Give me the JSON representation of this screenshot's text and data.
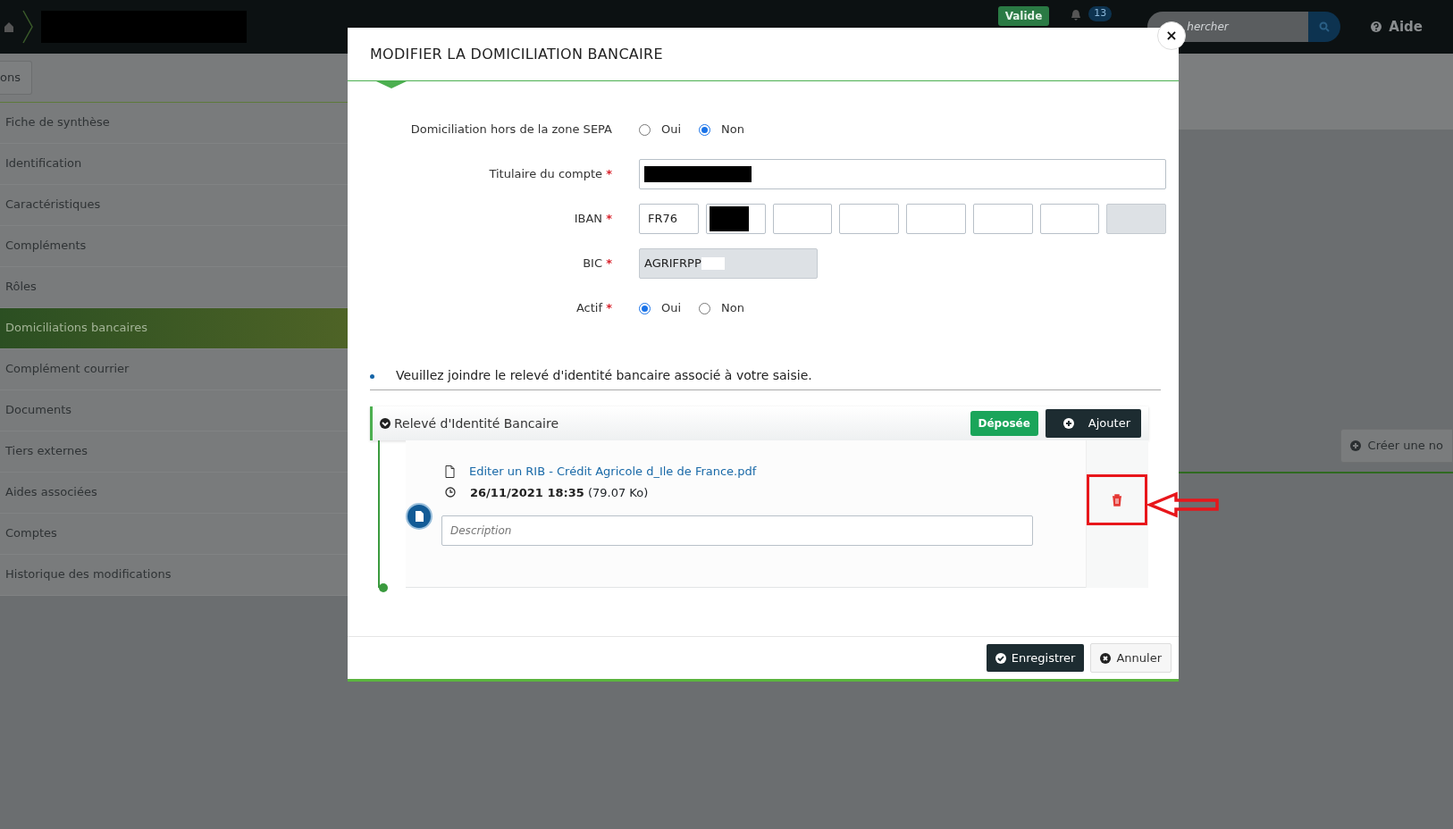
{
  "top_bar": {
    "status_badge": "Valide",
    "notification_count": "13",
    "search": {
      "placeholder": "hercher"
    },
    "help": "Aide"
  },
  "page": {
    "actions_button": "ons",
    "sidebar": {
      "items": [
        {
          "label": "Fiche de synthèse",
          "selected": false
        },
        {
          "label": "Identification",
          "selected": false
        },
        {
          "label": "Caractéristiques",
          "selected": false
        },
        {
          "label": "Compléments",
          "selected": false
        },
        {
          "label": "Rôles",
          "selected": false
        },
        {
          "label": "Domiciliations bancaires",
          "selected": true
        },
        {
          "label": "Complément courrier",
          "selected": false
        },
        {
          "label": "Documents",
          "selected": false
        },
        {
          "label": "Tiers externes",
          "selected": false
        },
        {
          "label": "Aides associées",
          "selected": false
        },
        {
          "label": "Comptes",
          "selected": false
        },
        {
          "label": "Historique des modifications",
          "selected": false
        }
      ]
    },
    "create_button": "Créer une no"
  },
  "modal": {
    "title": "MODIFIER LA DOMICILIATION BANCAIRE",
    "close_button": "×",
    "fields": [
      {
        "kind": "radio",
        "label": "Domiciliation hors de la zone SEPA",
        "options": [
          {
            "label": "Oui",
            "selected": false
          },
          {
            "label": "Non",
            "selected": true
          }
        ]
      },
      {
        "kind": "text",
        "label": "Titulaire du compte",
        "required_marker": "*",
        "redacted": true,
        "disabled": false
      },
      {
        "kind": "iban",
        "label": "IBAN",
        "required_marker": "*",
        "segments": [
          {
            "value": "FR76",
            "redacted": false,
            "disabled": false
          },
          {
            "redacted": true,
            "disabled": false
          },
          {
            "redacted": false,
            "disabled": false
          },
          {
            "redacted": false,
            "disabled": false
          },
          {
            "redacted": false,
            "disabled": false
          },
          {
            "redacted": false,
            "disabled": false
          },
          {
            "redacted": false,
            "disabled": false
          },
          {
            "redacted": false,
            "disabled": true
          }
        ]
      },
      {
        "kind": "text",
        "label": "BIC",
        "required_marker": "*",
        "value": "AGRIFRPP",
        "redacted": true,
        "disabled": true
      },
      {
        "kind": "radio",
        "label": "Actif",
        "required_marker": "*",
        "options": [
          {
            "label": "Oui",
            "selected": true
          },
          {
            "label": "Non",
            "selected": false
          }
        ]
      }
    ],
    "notice": "Veuillez joindre le relevé d'identité bancaire associé à votre saisie.",
    "attachment_panel": {
      "title": "Relevé d'Identité Bancaire",
      "expanded": true,
      "status": "Déposée",
      "add_button": "Ajouter",
      "files": [
        {
          "name": "Editer un RIB - Crédit Agricole d_Ile de France.pdf",
          "date": "26/11/2021 18:35",
          "size": "(79.07 Ko)",
          "description_placeholder": "Description"
        }
      ]
    },
    "buttons": [
      {
        "label": "Enregistrer",
        "kind": "primary"
      },
      {
        "label": "Annuler",
        "kind": "secondary"
      }
    ]
  }
}
